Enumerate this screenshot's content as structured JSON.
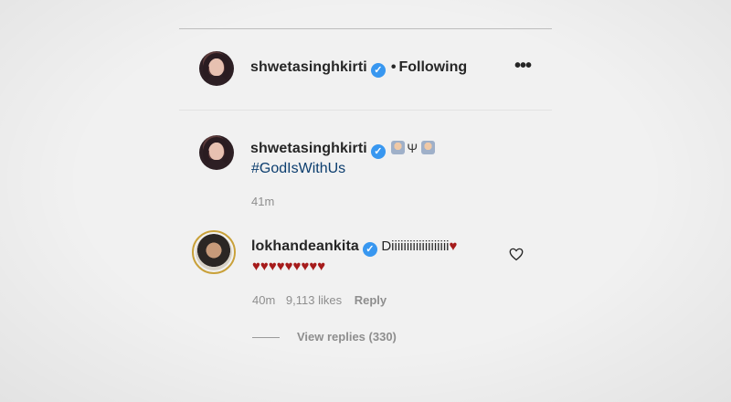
{
  "post": {
    "author": "shwetasinghkirti",
    "separator": "•",
    "follow_status": "Following",
    "more_label": "•••"
  },
  "caption": {
    "author": "shwetasinghkirti",
    "emoji_middle": "Ψ",
    "hashtag": "#GodIsWithUs",
    "time": "41m"
  },
  "comment": {
    "author": "lokhandeankita",
    "text": "Diiiiiiiiiiiiiiiiiii",
    "heart": "♥",
    "hearts_line": "♥♥♥♥♥♥♥♥♥",
    "time": "40m",
    "likes": "9,113 likes",
    "reply_label": "Reply",
    "view_replies": "View replies (330)"
  },
  "colors": {
    "verified": "#3897f0",
    "hashtag": "#0b3d6e",
    "heart": "#a61b1b",
    "meta": "#8e8e8e"
  }
}
